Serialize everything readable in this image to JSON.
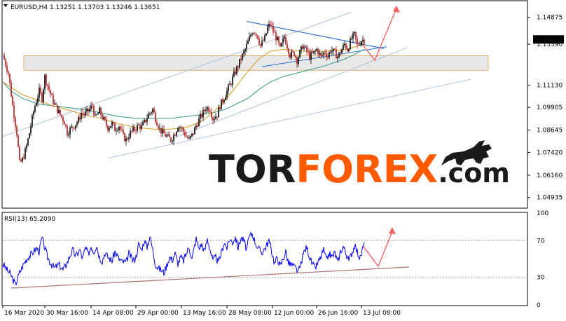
{
  "chart_data": [
    {
      "type": "candlestick",
      "symbol_line": "EURUSD,H4  1.13251 1.13703 1.13246 1.13651",
      "last_price": "1.13651",
      "ylim": [
        1.0438,
        1.1575
      ],
      "y_ticks": [
        "1.14875",
        "1.13390",
        "1.11130",
        "1.09905",
        "1.08645",
        "1.07420",
        "1.06160",
        "1.04935"
      ],
      "y_tick_values": [
        1.14875,
        1.1339,
        1.1113,
        1.09905,
        1.08645,
        1.0742,
        1.0616,
        1.04935
      ],
      "close_path": [
        [
          0,
          1.128
        ],
        [
          4,
          1.123
        ],
        [
          8,
          1.118
        ],
        [
          14,
          1.1
        ],
        [
          20,
          1.085
        ],
        [
          24,
          1.068
        ],
        [
          28,
          1.07
        ],
        [
          33,
          1.076
        ],
        [
          37,
          1.083
        ],
        [
          42,
          1.093
        ],
        [
          46,
          1.1
        ],
        [
          52,
          1.108
        ],
        [
          56,
          1.104
        ],
        [
          60,
          1.116
        ],
        [
          65,
          1.11
        ],
        [
          71,
          1.103
        ],
        [
          76,
          1.099
        ],
        [
          82,
          1.095
        ],
        [
          88,
          1.091
        ],
        [
          92,
          1.085
        ],
        [
          96,
          1.087
        ],
        [
          102,
          1.089
        ],
        [
          108,
          1.092
        ],
        [
          112,
          1.096
        ],
        [
          116,
          1.095
        ],
        [
          122,
          1.097
        ],
        [
          128,
          1.1
        ],
        [
          132,
          1.093
        ],
        [
          138,
          1.097
        ],
        [
          144,
          1.092
        ],
        [
          150,
          1.088
        ],
        [
          156,
          1.09
        ],
        [
          160,
          1.087
        ],
        [
          166,
          1.089
        ],
        [
          172,
          1.083
        ],
        [
          176,
          1.081
        ],
        [
          182,
          1.085
        ],
        [
          188,
          1.087
        ],
        [
          194,
          1.089
        ],
        [
          198,
          1.088
        ],
        [
          204,
          1.092
        ],
        [
          208,
          1.095
        ],
        [
          214,
          1.098
        ],
        [
          218,
          1.093
        ],
        [
          224,
          1.087
        ],
        [
          228,
          1.085
        ],
        [
          234,
          1.083
        ],
        [
          240,
          1.081
        ],
        [
          246,
          1.085
        ],
        [
          250,
          1.089
        ],
        [
          256,
          1.087
        ],
        [
          262,
          1.083
        ],
        [
          266,
          1.081
        ],
        [
          272,
          1.085
        ],
        [
          276,
          1.089
        ],
        [
          280,
          1.092
        ],
        [
          286,
          1.096
        ],
        [
          290,
          1.099
        ],
        [
          296,
          1.098
        ],
        [
          300,
          1.093
        ],
        [
          306,
          1.095
        ],
        [
          310,
          1.1
        ],
        [
          314,
          1.103
        ],
        [
          320,
          1.108
        ],
        [
          326,
          1.113
        ],
        [
          330,
          1.117
        ],
        [
          336,
          1.122
        ],
        [
          340,
          1.126
        ],
        [
          344,
          1.129
        ],
        [
          348,
          1.133
        ],
        [
          352,
          1.137
        ],
        [
          356,
          1.141
        ],
        [
          360,
          1.141
        ],
        [
          364,
          1.138
        ],
        [
          368,
          1.133
        ],
        [
          374,
          1.137
        ],
        [
          378,
          1.143
        ],
        [
          382,
          1.145
        ],
        [
          386,
          1.141
        ],
        [
          392,
          1.136
        ],
        [
          396,
          1.131
        ],
        [
          402,
          1.138
        ],
        [
          406,
          1.133
        ],
        [
          410,
          1.128
        ],
        [
          416,
          1.129
        ],
        [
          420,
          1.125
        ],
        [
          424,
          1.129
        ],
        [
          428,
          1.133
        ],
        [
          434,
          1.13
        ],
        [
          438,
          1.127
        ],
        [
          444,
          1.129
        ],
        [
          448,
          1.131
        ],
        [
          454,
          1.127
        ],
        [
          460,
          1.13
        ],
        [
          464,
          1.127
        ],
        [
          468,
          1.131
        ],
        [
          474,
          1.129
        ],
        [
          478,
          1.127
        ],
        [
          484,
          1.131
        ],
        [
          488,
          1.134
        ],
        [
          492,
          1.131
        ],
        [
          498,
          1.137
        ],
        [
          502,
          1.139
        ],
        [
          506,
          1.133
        ],
        [
          512,
          1.136
        ],
        [
          516,
          1.1365
        ]
      ],
      "ma_fast": [
        [
          0,
          1.113
        ],
        [
          12,
          1.11
        ],
        [
          28,
          1.106
        ],
        [
          50,
          1.103
        ],
        [
          70,
          1.1
        ],
        [
          90,
          1.098
        ],
        [
          115,
          1.095
        ],
        [
          140,
          1.093
        ],
        [
          165,
          1.09
        ],
        [
          190,
          1.088
        ],
        [
          215,
          1.087
        ],
        [
          240,
          1.087
        ],
        [
          262,
          1.088
        ],
        [
          282,
          1.091
        ],
        [
          300,
          1.096
        ],
        [
          318,
          1.103
        ],
        [
          334,
          1.111
        ],
        [
          350,
          1.119
        ],
        [
          366,
          1.126
        ],
        [
          382,
          1.13
        ],
        [
          400,
          1.131
        ],
        [
          430,
          1.13
        ],
        [
          460,
          1.13
        ],
        [
          490,
          1.131
        ],
        [
          516,
          1.134
        ]
      ],
      "ma_slow": [
        [
          0,
          1.113
        ],
        [
          12,
          1.108
        ],
        [
          28,
          1.104
        ],
        [
          50,
          1.101
        ],
        [
          70,
          1.1
        ],
        [
          90,
          1.099
        ],
        [
          115,
          1.098
        ],
        [
          140,
          1.096
        ],
        [
          165,
          1.094
        ],
        [
          190,
          1.093
        ],
        [
          215,
          1.093
        ],
        [
          240,
          1.093
        ],
        [
          262,
          1.094
        ],
        [
          282,
          1.095
        ],
        [
          300,
          1.096
        ],
        [
          318,
          1.098
        ],
        [
          334,
          1.101
        ],
        [
          350,
          1.104
        ],
        [
          366,
          1.109
        ],
        [
          382,
          1.113
        ],
        [
          400,
          1.116
        ],
        [
          430,
          1.119
        ],
        [
          460,
          1.122
        ],
        [
          490,
          1.126
        ],
        [
          516,
          1.131
        ]
      ],
      "colors": {
        "bull": "#000000",
        "bear": "#b01818",
        "ma_fast": "#d99a1e",
        "ma_slow": "#2e9a86",
        "trendline": "#b0c4de",
        "triangle": "#2f6fd6",
        "arrow": "#f06060",
        "zone": "#e8e8e8",
        "zone_border": "#e0b070"
      }
    },
    {
      "type": "line",
      "title": "RSI(13) 65.2090",
      "ylim": [
        0,
        100
      ],
      "y_ticks": [
        "100",
        "70",
        "30",
        "0"
      ],
      "y_tick_values": [
        100,
        70,
        30,
        0
      ],
      "series": [
        {
          "values": [
            [
              0,
              45
            ],
            [
              6,
              38
            ],
            [
              12,
              32
            ],
            [
              18,
              22
            ],
            [
              24,
              35
            ],
            [
              30,
              45
            ],
            [
              36,
              52
            ],
            [
              42,
              56
            ],
            [
              48,
              62
            ],
            [
              52,
              58
            ],
            [
              56,
              73
            ],
            [
              60,
              62
            ],
            [
              64,
              52
            ],
            [
              68,
              46
            ],
            [
              74,
              40
            ],
            [
              80,
              44
            ],
            [
              86,
              38
            ],
            [
              92,
              46
            ],
            [
              96,
              54
            ],
            [
              100,
              60
            ],
            [
              104,
              53
            ],
            [
              110,
              60
            ],
            [
              114,
              50
            ],
            [
              118,
              62
            ],
            [
              122,
              55
            ],
            [
              126,
              64
            ],
            [
              130,
              58
            ],
            [
              134,
              65
            ],
            [
              138,
              52
            ],
            [
              142,
              48
            ],
            [
              146,
              57
            ],
            [
              150,
              52
            ],
            [
              156,
              48
            ],
            [
              160,
              58
            ],
            [
              166,
              50
            ],
            [
              170,
              47
            ],
            [
              176,
              46
            ],
            [
              180,
              56
            ],
            [
              186,
              48
            ],
            [
              190,
              52
            ],
            [
              194,
              66
            ],
            [
              198,
              60
            ],
            [
              202,
              70
            ],
            [
              206,
              63
            ],
            [
              210,
              75
            ],
            [
              214,
              60
            ],
            [
              218,
              44
            ],
            [
              222,
              40
            ],
            [
              226,
              38
            ],
            [
              230,
              35
            ],
            [
              234,
              43
            ],
            [
              238,
              52
            ],
            [
              242,
              49
            ],
            [
              246,
              56
            ],
            [
              250,
              45
            ],
            [
              254,
              52
            ],
            [
              258,
              48
            ],
            [
              262,
              56
            ],
            [
              266,
              63
            ],
            [
              270,
              50
            ],
            [
              276,
              72
            ],
            [
              280,
              62
            ],
            [
              284,
              66
            ],
            [
              288,
              58
            ],
            [
              292,
              72
            ],
            [
              296,
              60
            ],
            [
              300,
              48
            ],
            [
              304,
              52
            ],
            [
              308,
              46
            ],
            [
              312,
              57
            ],
            [
              316,
              68
            ],
            [
              320,
              62
            ],
            [
              324,
              72
            ],
            [
              328,
              68
            ],
            [
              332,
              74
            ],
            [
              336,
              62
            ],
            [
              340,
              73
            ],
            [
              344,
              70
            ],
            [
              348,
              60
            ],
            [
              352,
              74
            ],
            [
              356,
              78
            ],
            [
              360,
              69
            ],
            [
              364,
              62
            ],
            [
              370,
              57
            ],
            [
              376,
              64
            ],
            [
              380,
              70
            ],
            [
              384,
              58
            ],
            [
              388,
              45
            ],
            [
              392,
              52
            ],
            [
              396,
              42
            ],
            [
              400,
              50
            ],
            [
              404,
              58
            ],
            [
              408,
              45
            ],
            [
              412,
              44
            ],
            [
              418,
              40
            ],
            [
              422,
              36
            ],
            [
              426,
              46
            ],
            [
              430,
              58
            ],
            [
              434,
              63
            ],
            [
              438,
              52
            ],
            [
              442,
              44
            ],
            [
              446,
              40
            ],
            [
              450,
              46
            ],
            [
              454,
              52
            ],
            [
              458,
              60
            ],
            [
              462,
              48
            ],
            [
              466,
              56
            ],
            [
              470,
              52
            ],
            [
              474,
              57
            ],
            [
              478,
              46
            ],
            [
              482,
              58
            ],
            [
              486,
              64
            ],
            [
              490,
              56
            ],
            [
              494,
              48
            ],
            [
              498,
              56
            ],
            [
              502,
              64
            ],
            [
              506,
              58
            ],
            [
              510,
              50
            ],
            [
              514,
              62
            ],
            [
              516,
              65.209
            ]
          ]
        }
      ],
      "colors": {
        "line": "#0000ff",
        "trendline": "#b07070",
        "arrow": "#f06060",
        "levels": "#a0a0a0"
      }
    }
  ],
  "x_axis": {
    "labels": [
      "16 Mar 2020",
      "30 Mar 16:00",
      "14 Apr 08:00",
      "29 Apr 00:00",
      "13 May 16:00",
      "28 May 08:00",
      "12 Jun 00:00",
      "26 Jun 16:00",
      "13 Jul 08:00"
    ],
    "positions": [
      0,
      60,
      126,
      190,
      255,
      320,
      385,
      448,
      512
    ]
  },
  "watermark": {
    "part1": "TOR",
    "part2": "FOREX",
    "part3": ".com",
    "color1": "#1a1a1a",
    "color2": "#ff5a00"
  },
  "icons": {
    "logo": "bull-icon",
    "indicator": "triangle-down-icon"
  }
}
